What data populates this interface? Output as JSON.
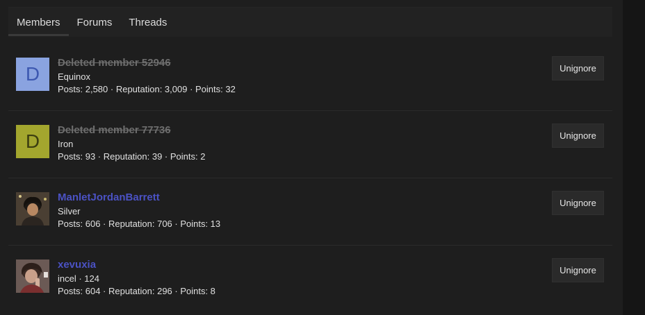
{
  "tabs": [
    {
      "label": "Members",
      "active": true
    },
    {
      "label": "Forums",
      "active": false
    },
    {
      "label": "Threads",
      "active": false
    }
  ],
  "members": [
    {
      "name": "Deleted member 52946",
      "deleted": true,
      "avatar_letter": "D",
      "avatar_bg": "#8aa3e0",
      "avatar_fg": "#3d58b0",
      "title": "Equinox",
      "stats": "Posts: 2,580 · Reputation: 3,009 · Points: 32",
      "button": "Unignore"
    },
    {
      "name": "Deleted member 77736",
      "deleted": true,
      "avatar_letter": "D",
      "avatar_bg": "#a3a62e",
      "avatar_fg": "#3c3e10",
      "title": "Iron",
      "stats": "Posts: 93 · Reputation: 39 · Points: 2",
      "button": "Unignore"
    },
    {
      "name": "ManletJordanBarrett",
      "deleted": false,
      "avatar_letter": "",
      "title": "Silver",
      "stats": "Posts: 606 · Reputation: 706 · Points: 13",
      "button": "Unignore"
    },
    {
      "name": "xevuxia",
      "deleted": false,
      "avatar_letter": "",
      "title": "incel · 124",
      "stats": "Posts: 604 · Reputation: 296 · Points: 8",
      "button": "Unignore"
    }
  ],
  "colors": {
    "username_link": "#4b52c4",
    "deleted_name": "#6e6e6e",
    "background": "#1e1e1e"
  }
}
